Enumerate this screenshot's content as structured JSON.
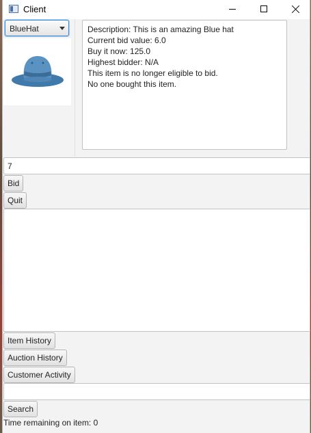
{
  "window": {
    "title": "Client"
  },
  "item_selector": {
    "selected": "BlueHat"
  },
  "description": {
    "lines": [
      "Description: This is an amazing Blue hat",
      "Current bid value: 6.0",
      "Buy it now: 125.0",
      "Highest bidder: N/A",
      "This item is no longer eligible to bid.",
      "No one bought this item."
    ]
  },
  "bid": {
    "input_value": "7",
    "bid_label": "Bid",
    "quit_label": "Quit"
  },
  "history_buttons": {
    "item_history": "Item History",
    "auction_history": "Auction History",
    "customer_activity": "Customer Activity"
  },
  "search": {
    "input_value": "",
    "button_label": "Search"
  },
  "status": {
    "time_remaining": "Time remaining on item: 0"
  },
  "colors": {
    "hat": "#4f86b5",
    "hat_dark": "#3a6d97",
    "accent_focus": "#3d8ad8"
  },
  "icons": {
    "app": "window-app-icon",
    "minimize": "minimize-icon",
    "maximize": "maximize-icon",
    "close": "close-icon"
  }
}
